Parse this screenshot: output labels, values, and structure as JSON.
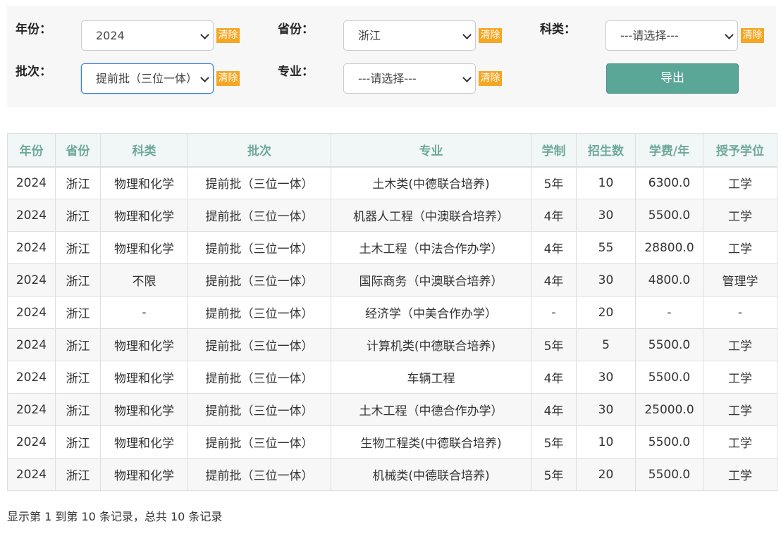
{
  "filters": {
    "year": {
      "label": "年份：",
      "value": "2024",
      "clear": "清除"
    },
    "province": {
      "label": "省份：",
      "value": "浙江",
      "clear": "清除"
    },
    "subject": {
      "label": "科类：",
      "value": "---请选择---",
      "clear": "清除"
    },
    "batch": {
      "label": "批次：",
      "value": "提前批（三位一体）",
      "clear": "清除"
    },
    "major": {
      "label": "专业：",
      "value": "---请选择---",
      "clear": "清除"
    },
    "export_label": "导出"
  },
  "table": {
    "headers": [
      "年份",
      "省份",
      "科类",
      "批次",
      "专业",
      "学制",
      "招生数",
      "学费/年",
      "授予学位"
    ],
    "rows": [
      [
        "2024",
        "浙江",
        "物理和化学",
        "提前批（三位一体）",
        "土木类(中德联合培养)",
        "5年",
        "10",
        "6300.0",
        "工学"
      ],
      [
        "2024",
        "浙江",
        "物理和化学",
        "提前批（三位一体）",
        "机器人工程（中澳联合培养）",
        "4年",
        "30",
        "5500.0",
        "工学"
      ],
      [
        "2024",
        "浙江",
        "物理和化学",
        "提前批（三位一体）",
        "土木工程（中法合作办学）",
        "4年",
        "55",
        "28800.0",
        "工学"
      ],
      [
        "2024",
        "浙江",
        "不限",
        "提前批（三位一体）",
        "国际商务（中澳联合培养）",
        "4年",
        "30",
        "4800.0",
        "管理学"
      ],
      [
        "2024",
        "浙江",
        "-",
        "提前批（三位一体）",
        "经济学（中美合作办学）",
        "-",
        "20",
        "-",
        "-"
      ],
      [
        "2024",
        "浙江",
        "物理和化学",
        "提前批（三位一体）",
        "计算机类(中德联合培养)",
        "5年",
        "5",
        "5500.0",
        "工学"
      ],
      [
        "2024",
        "浙江",
        "物理和化学",
        "提前批（三位一体）",
        "车辆工程",
        "4年",
        "30",
        "5500.0",
        "工学"
      ],
      [
        "2024",
        "浙江",
        "物理和化学",
        "提前批（三位一体）",
        "土木工程（中德合作办学）",
        "4年",
        "30",
        "25000.0",
        "工学"
      ],
      [
        "2024",
        "浙江",
        "物理和化学",
        "提前批（三位一体）",
        "生物工程类(中德联合培养)",
        "5年",
        "10",
        "5500.0",
        "工学"
      ],
      [
        "2024",
        "浙江",
        "物理和化学",
        "提前批（三位一体）",
        "机械类(中德联合培养)",
        "5年",
        "20",
        "5500.0",
        "工学"
      ]
    ]
  },
  "pagination": {
    "summary": "显示第 1 到第 10 条记录，总共 10 条记录"
  }
}
